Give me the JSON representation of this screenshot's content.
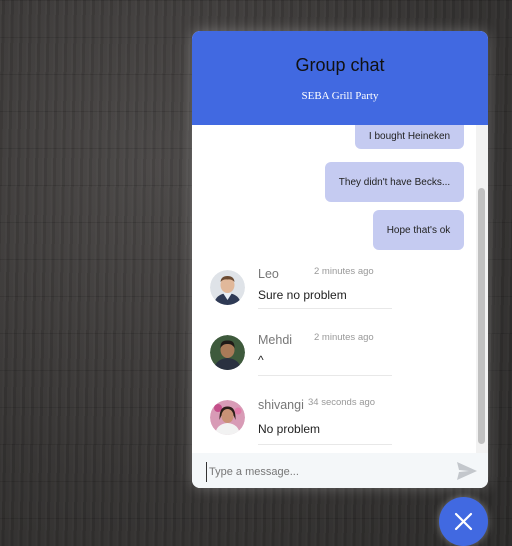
{
  "header": {
    "title": "Group chat",
    "subtitle": "SEBA Grill Party"
  },
  "outgoing": [
    {
      "text": "I bought Heineken"
    },
    {
      "text": "They didn't have Becks..."
    },
    {
      "text": "Hope that's ok"
    }
  ],
  "incoming": [
    {
      "sender": "Leo",
      "time": "2 minutes ago",
      "text": "Sure no problem"
    },
    {
      "sender": "Mehdi",
      "time": "2 minutes ago",
      "text": "^"
    },
    {
      "sender": "shivangi",
      "time": "34 seconds ago",
      "text": "No problem"
    }
  ],
  "composer": {
    "placeholder": "Type a message..."
  },
  "colors": {
    "accent": "#4169e1",
    "bubble": "#c5cbf1"
  },
  "icons": {
    "send": "send-icon",
    "close": "close-icon"
  }
}
